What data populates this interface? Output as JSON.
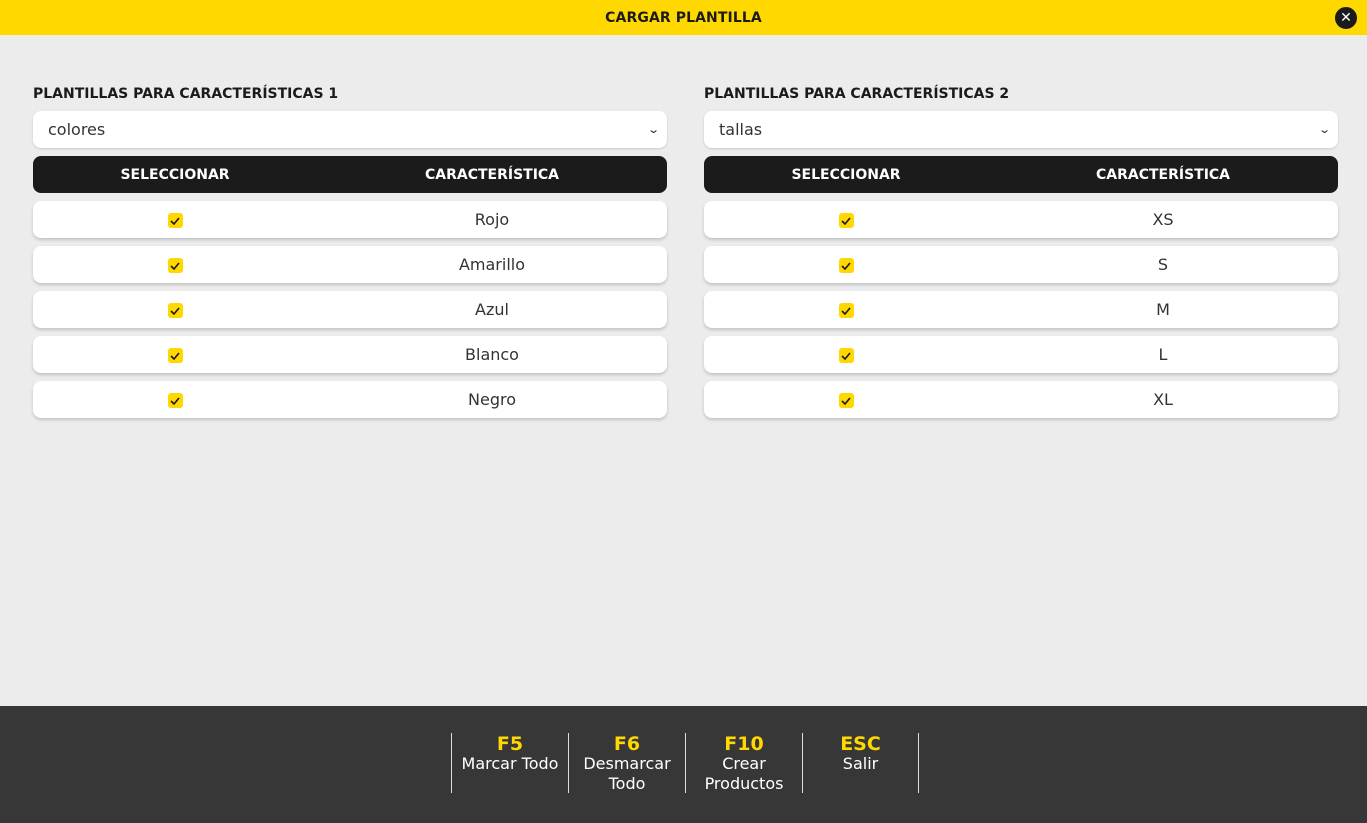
{
  "window": {
    "title": "CARGAR PLANTILLA"
  },
  "panel1": {
    "label": "PLANTILLAS PARA CARACTERÍSTICAS 1",
    "selected": "colores",
    "header": {
      "select": "SELECCIONAR",
      "feature": "CARACTERÍSTICA"
    },
    "rows": [
      {
        "checked": true,
        "value": "Rojo"
      },
      {
        "checked": true,
        "value": "Amarillo"
      },
      {
        "checked": true,
        "value": "Azul"
      },
      {
        "checked": true,
        "value": "Blanco"
      },
      {
        "checked": true,
        "value": "Negro"
      }
    ]
  },
  "panel2": {
    "label": "PLANTILLAS PARA CARACTERÍSTICAS 2",
    "selected": "tallas",
    "header": {
      "select": "SELECCIONAR",
      "feature": "CARACTERÍSTICA"
    },
    "rows": [
      {
        "checked": true,
        "value": "XS"
      },
      {
        "checked": true,
        "value": "S"
      },
      {
        "checked": true,
        "value": "M"
      },
      {
        "checked": true,
        "value": "L"
      },
      {
        "checked": true,
        "value": "XL"
      }
    ]
  },
  "footer": {
    "keys": [
      {
        "key": "F5",
        "label": "Marcar Todo"
      },
      {
        "key": "F6",
        "label": "Desmarcar Todo"
      },
      {
        "key": "F10",
        "label": "Crear Productos"
      },
      {
        "key": "ESC",
        "label": "Salir"
      }
    ]
  },
  "colors": {
    "accent": "#ffd800",
    "dark": "#1b1b1b",
    "footer": "#373737",
    "background": "#ececec"
  },
  "icons": {
    "close": "close-icon",
    "check": "check-icon",
    "dropdown": "chevron-down-icon"
  }
}
